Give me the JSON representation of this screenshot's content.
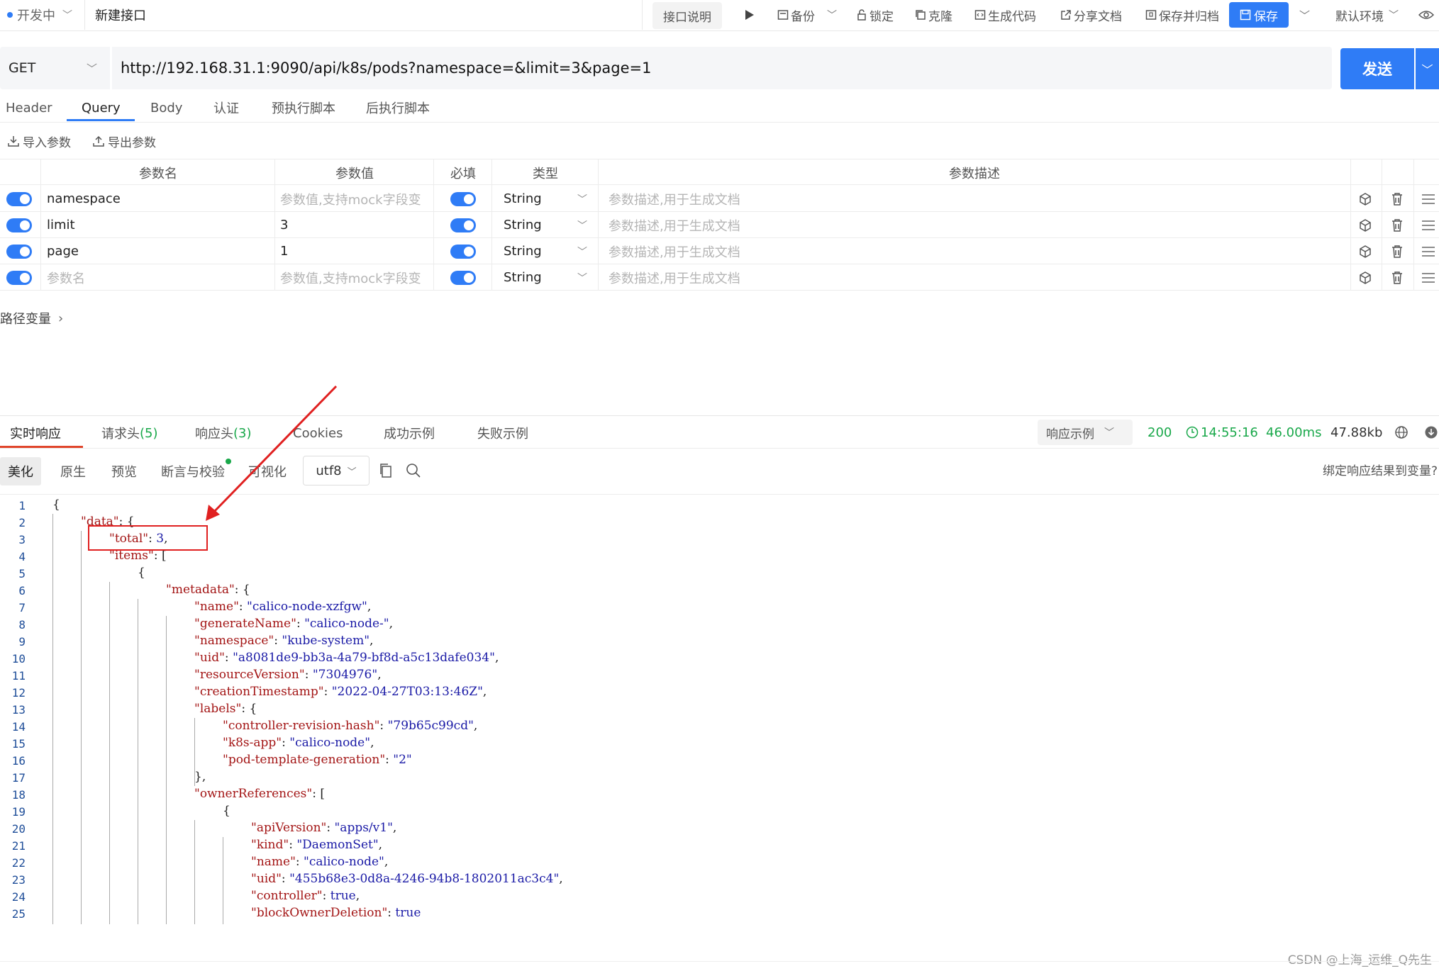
{
  "topbar": {
    "status": "开发中",
    "name_value": "新建接口",
    "doc_label": "接口说明",
    "items": [
      {
        "id": "backup",
        "label": "备份"
      },
      {
        "id": "lock",
        "label": "锁定"
      },
      {
        "id": "clone",
        "label": "克隆"
      },
      {
        "id": "gencode",
        "label": "生成代码"
      },
      {
        "id": "share",
        "label": "分享文档"
      },
      {
        "id": "save-archive",
        "label": "保存并归档"
      }
    ],
    "save_label": "保存",
    "env_label": "默认环境"
  },
  "request": {
    "method": "GET",
    "url": "http://192.168.31.1:9090/api/k8s/pods?namespace=&limit=3&page=1",
    "send_label": "发送",
    "tabs": [
      "Header",
      "Query",
      "Body",
      "认证",
      "预执行脚本",
      "后执行脚本"
    ],
    "active_tab": "Query",
    "import_label": "导入参数",
    "export_label": "导出参数"
  },
  "params": {
    "headers": {
      "name": "参数名",
      "value": "参数值",
      "required": "必填",
      "type": "类型",
      "desc": "参数描述"
    },
    "rows": [
      {
        "name": "namespace",
        "value": "",
        "type": "String"
      },
      {
        "name": "limit",
        "value": "3",
        "type": "String"
      },
      {
        "name": "page",
        "value": "1",
        "type": "String"
      },
      {
        "name": "",
        "value": "",
        "type": "String"
      }
    ],
    "name_placeholder": "参数名",
    "value_placeholder": "参数值,支持mock字段变",
    "desc_placeholder": "参数描述,用于生成文档",
    "path_vars_label": "路径变量"
  },
  "response": {
    "tabs": [
      {
        "label": "实时响应"
      },
      {
        "label": "请求头",
        "count": "(5)"
      },
      {
        "label": "响应头",
        "count": "(3)"
      },
      {
        "label": "Cookies"
      },
      {
        "label": "成功示例"
      },
      {
        "label": "失败示例"
      }
    ],
    "example_label": "响应示例",
    "status_code": "200",
    "time": "14:55:16",
    "duration": "46.00ms",
    "size": "47.88kb",
    "formats": [
      "美化",
      "原生",
      "预览",
      "断言与校验",
      "可视化"
    ],
    "charset": "utf8",
    "bind_label": "绑定响应结果到变量?",
    "code_lines": [
      "{",
      "\"data\": {",
      "\"total\": 3,",
      "\"items\": [",
      "{",
      "\"metadata\": {",
      "\"name\": \"calico-node-xzfgw\",",
      "\"generateName\": \"calico-node-\",",
      "\"namespace\": \"kube-system\",",
      "\"uid\": \"a8081de9-bb3a-4a79-bf8d-a5c13dafe034\",",
      "\"resourceVersion\": \"7304976\",",
      "\"creationTimestamp\": \"2022-04-27T03:13:46Z\",",
      "\"labels\": {",
      "\"controller-revision-hash\": \"79b65c99cd\",",
      "\"k8s-app\": \"calico-node\",",
      "\"pod-template-generation\": \"2\"",
      "},",
      "\"ownerReferences\": [",
      "{",
      "\"apiVersion\": \"apps/v1\",",
      "\"kind\": \"DaemonSet\",",
      "\"name\": \"calico-node\",",
      "\"uid\": \"455b68e3-0d8a-4246-94b8-1802011ac3c4\",",
      "\"controller\": true,",
      "\"blockOwnerDeletion\": true"
    ]
  },
  "watermark": "CSDN @上海_运维_Q先生",
  "colors": {
    "accent": "#2f7cf6",
    "success": "#19a84a",
    "highlight": "#e02020"
  }
}
